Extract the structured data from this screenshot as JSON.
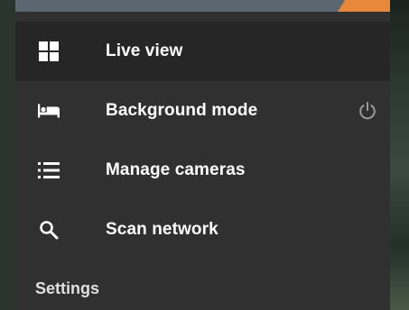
{
  "menu": {
    "items": [
      {
        "label": "Live view",
        "icon": "grid-icon",
        "active": true
      },
      {
        "label": "Background mode",
        "icon": "bed-icon",
        "active": false,
        "trailing_icon": "power-icon"
      },
      {
        "label": "Manage cameras",
        "icon": "list-icon",
        "active": false
      },
      {
        "label": "Scan network",
        "icon": "search-icon",
        "active": false
      }
    ],
    "settings_header": "Settings"
  },
  "colors": {
    "drawer_background": "#303030",
    "active_item_background": "#262626",
    "accent": "#e8883a",
    "header": "#5b6770",
    "text": "#ffffff"
  }
}
